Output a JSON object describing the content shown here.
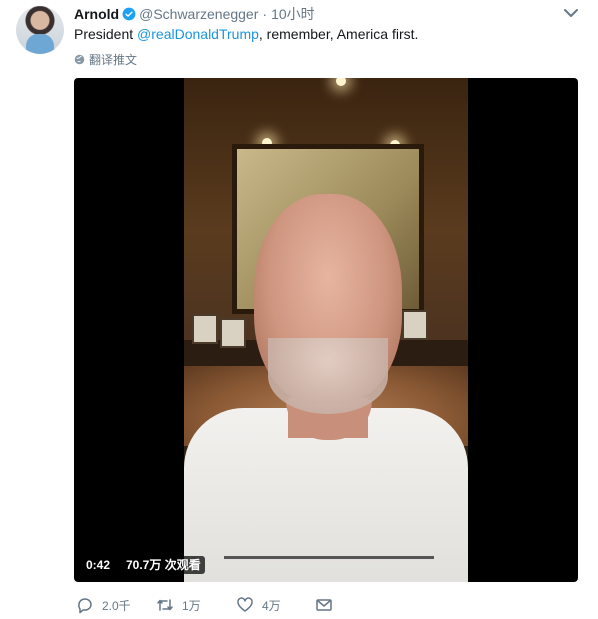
{
  "tweet": {
    "author_name": "Arnold",
    "author_handle": "@Schwarzenegger",
    "separator": "·",
    "time": "10小时",
    "text_prefix": "President ",
    "mention": "@realDonaldTrump",
    "text_suffix": ", remember, America first.",
    "translate_label": "翻译推文",
    "accent_color": "#1b95e0"
  },
  "video": {
    "duration": "0:42",
    "views": "70.7万 次观看"
  },
  "actions": {
    "reply_count": "2.0千",
    "retweet_count": "1万",
    "like_count": "4万"
  },
  "icons": [
    "verified-icon",
    "caret-down-icon",
    "globe-icon",
    "reply-icon",
    "retweet-icon",
    "like-icon",
    "message-icon"
  ]
}
